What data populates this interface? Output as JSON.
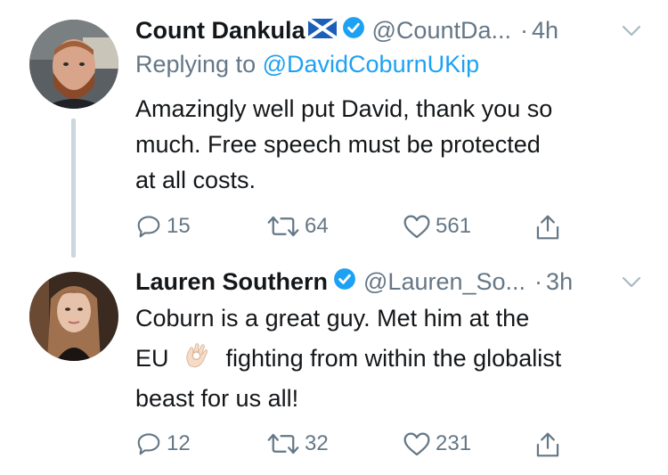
{
  "tweets": [
    {
      "name": "Count Dankula",
      "flag_icon": "scotland-flag-icon",
      "handle": "@CountDa...",
      "dot": "·",
      "time": "4h",
      "replying_label": "Replying to ",
      "replying_to": "@DavidCoburnUKip",
      "text_lines": [
        "Amazingly well put David, thank you so",
        "much. Free speech must be protected",
        "at all costs."
      ],
      "replies": "15",
      "retweets": "64",
      "likes": "561"
    },
    {
      "name": "Lauren Southern",
      "handle": "@Lauren_So...",
      "dot": "·",
      "time": "3h",
      "text_lines": [
        "Coburn is a great guy. Met him at the",
        "EU",
        "fighting from within the globalist",
        "beast for us all!"
      ],
      "emoji_icon": "ok-hand-emoji-icon",
      "replies": "12",
      "retweets": "32",
      "likes": "231"
    }
  ],
  "colors": {
    "text": "#14171a",
    "muted": "#657786",
    "link": "#1da1f2",
    "verified": "#1da1f2",
    "thread_line": "#ccd6dd"
  }
}
